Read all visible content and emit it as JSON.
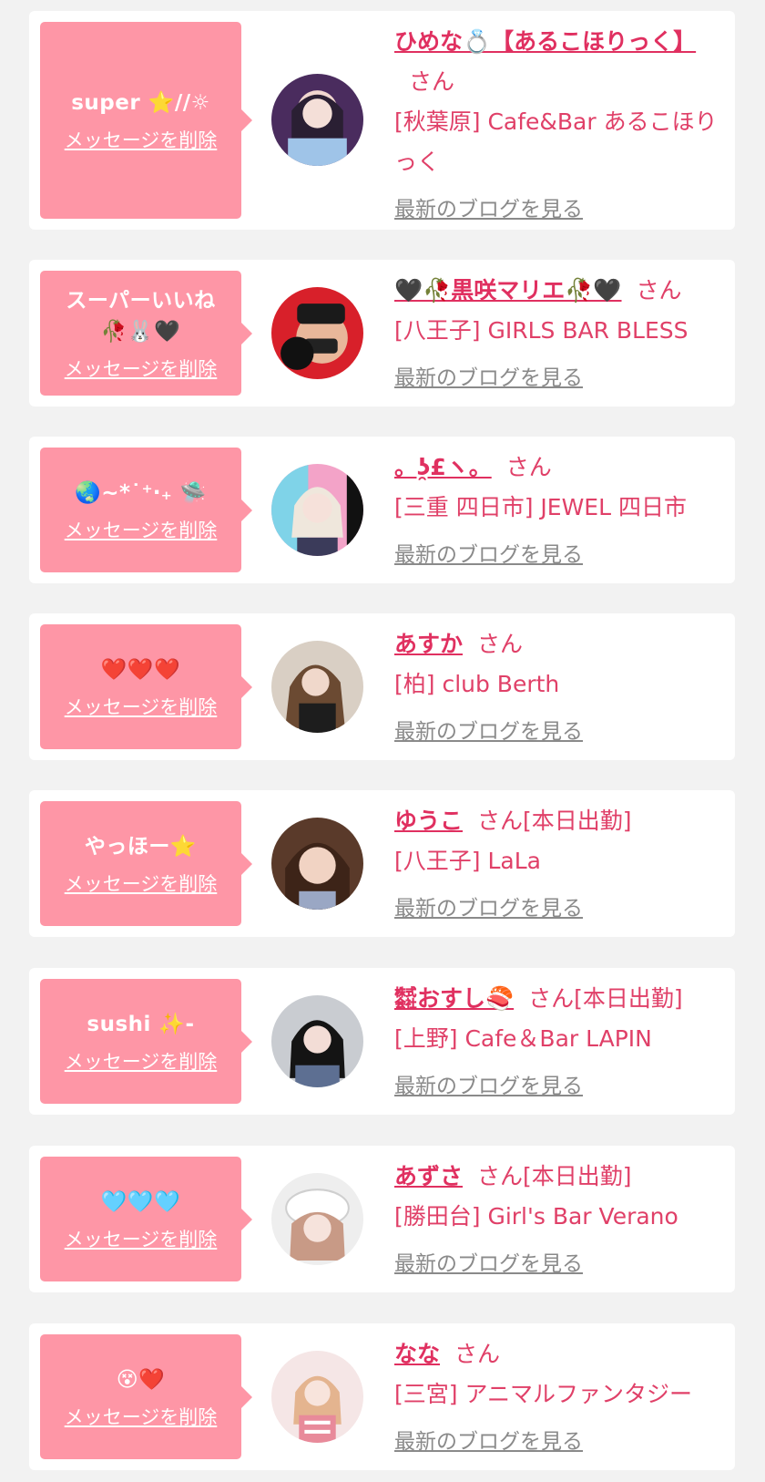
{
  "favorites": [
    {
      "stamp": "super ⭐//☼",
      "delete_label": "メッセージを削除",
      "avatar_icon": "profile-photo",
      "name": "ひめな💍【あるこほりっく】",
      "honorific": "さん",
      "status": "",
      "shop": "[秋葉原] Cafe&Bar あるこほりっく",
      "blog_label": "最新のブログを見る"
    },
    {
      "stamp": "スーパーいいね\n🥀🐰🖤",
      "delete_label": "メッセージを削除",
      "avatar_icon": "profile-photo",
      "name": "🖤🥀黒咲マリエ🥀🖤",
      "honorific": "さん",
      "status": "",
      "shop": "[八王子] GIRLS BAR BLESS",
      "blog_label": "最新のブログを見る"
    },
    {
      "stamp": "🌏~*˙⁺‧₊ 🛸",
      "delete_label": "メッセージを削除",
      "avatar_icon": "profile-photo",
      "name": "。ʖ̯£ヽ。",
      "honorific": "さん",
      "status": "",
      "shop": "[三重 四日市] JEWEL 四日市",
      "blog_label": "最新のブログを見る"
    },
    {
      "stamp": "❤️❤️❤️",
      "delete_label": "メッセージを削除",
      "avatar_icon": "profile-photo",
      "name": "あすか",
      "honorific": "さん",
      "status": "",
      "shop": "[柏] club Berth",
      "blog_label": "最新のブログを見る"
    },
    {
      "stamp": "やっほー⭐",
      "delete_label": "メッセージを削除",
      "avatar_icon": "profile-photo",
      "name": "ゆうこ",
      "honorific": "さん",
      "status": "[本日出勤]",
      "shop": "[八王子] LaLa",
      "blog_label": "最新のブログを見る"
    },
    {
      "stamp": "sushi ✨-",
      "delete_label": "メッセージを削除",
      "avatar_icon": "profile-photo",
      "name": "㍿おすし🍣",
      "honorific": "さん",
      "status": "[本日出勤]",
      "shop": "[上野] Cafe＆Bar LAPIN",
      "blog_label": "最新のブログを見る"
    },
    {
      "stamp": "🩵🩵🩵",
      "delete_label": "メッセージを削除",
      "avatar_icon": "profile-photo",
      "name": "あずさ",
      "honorific": "さん",
      "status": "[本日出勤]",
      "shop": "[勝田台] Girl's Bar Verano",
      "blog_label": "最新のブログを見る"
    },
    {
      "stamp": "😵❤️",
      "delete_label": "メッセージを削除",
      "avatar_icon": "profile-photo",
      "name": "なな",
      "honorific": "さん",
      "status": "",
      "shop": "[三宮] アニマルファンタジー",
      "blog_label": "最新のブログを見る"
    }
  ],
  "colors": {
    "page_bg": "#f2f2f2",
    "card_bg": "#ffffff",
    "bubble_bg": "#fe96a6",
    "accent_text": "#e04068",
    "link_gray": "#8a8a8a"
  }
}
